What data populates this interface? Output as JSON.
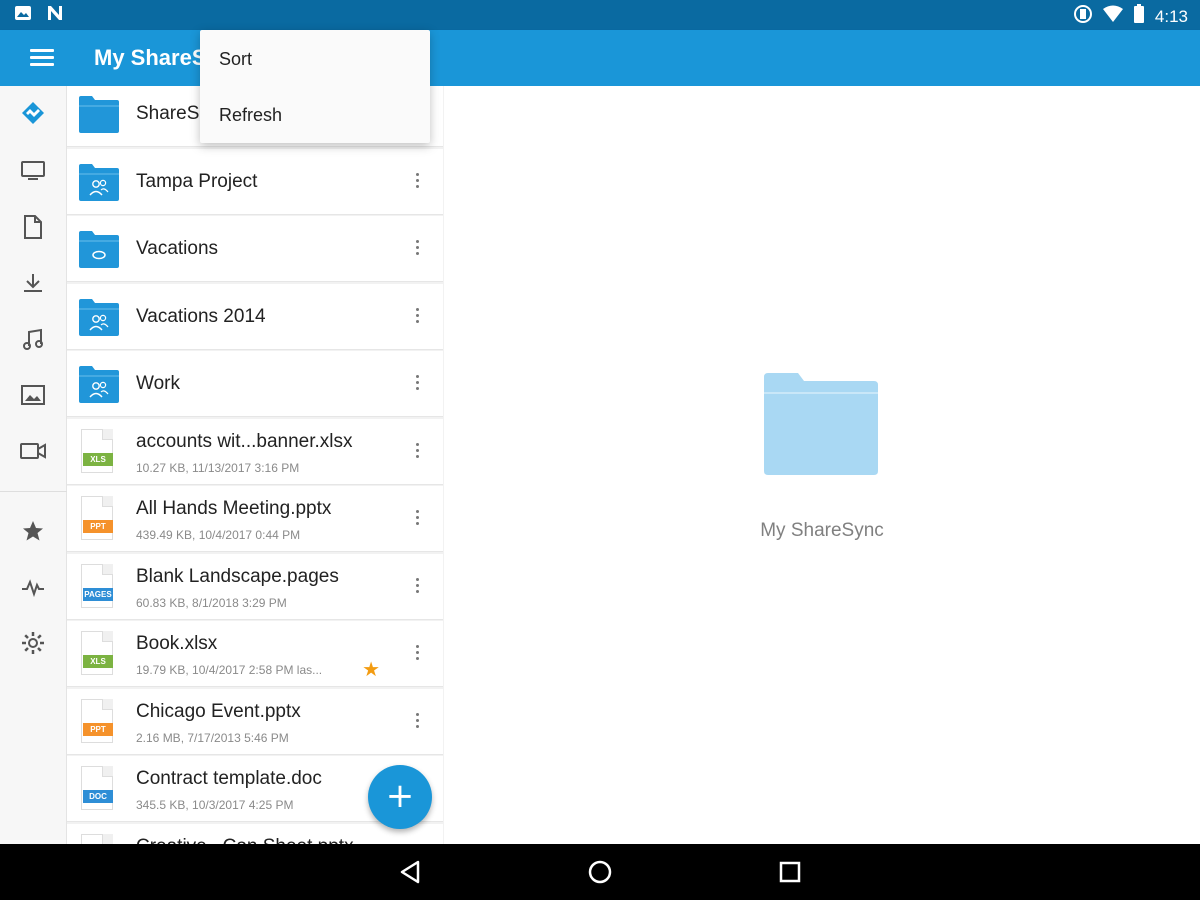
{
  "status_bar": {
    "time": "4:13"
  },
  "app_bar": {
    "title": "My ShareSync"
  },
  "menu": {
    "items": [
      {
        "label": "Sort"
      },
      {
        "label": "Refresh"
      }
    ]
  },
  "rail": {
    "items": [
      "sharesync-icon",
      "computer-icon",
      "document-icon",
      "download-icon",
      "music-icon",
      "image-icon",
      "video-icon",
      "star-icon",
      "activity-icon",
      "settings-icon"
    ]
  },
  "files": [
    {
      "name": "ShareS",
      "type": "folder",
      "variant": "plain"
    },
    {
      "name": "Tampa Project",
      "type": "folder",
      "variant": "shared"
    },
    {
      "name": "Vacations",
      "type": "folder",
      "variant": "link"
    },
    {
      "name": "Vacations 2014",
      "type": "folder",
      "variant": "shared"
    },
    {
      "name": "Work",
      "type": "folder",
      "variant": "shared"
    },
    {
      "name": "accounts wit...banner.xlsx",
      "type": "file",
      "badge": "XLS",
      "badge_color": "#7cb342",
      "meta": "10.27 KB, 11/13/2017 3:16 PM"
    },
    {
      "name": "All Hands Meeting.pptx",
      "type": "file",
      "badge": "PPT",
      "badge_color": "#f5922b",
      "meta": "439.49 KB, 10/4/2017 0:44 PM"
    },
    {
      "name": "Blank Landscape.pages",
      "type": "file",
      "badge": "PAGES",
      "badge_color": "#2e8ed6",
      "meta": "60.83 KB, 8/1/2018 3:29 PM"
    },
    {
      "name": "Book.xlsx",
      "type": "file",
      "badge": "XLS",
      "badge_color": "#7cb342",
      "meta": "19.79 KB, 10/4/2017 2:58 PM las...",
      "starred": true
    },
    {
      "name": "Chicago Event.pptx",
      "type": "file",
      "badge": "PPT",
      "badge_color": "#f5922b",
      "meta": "2.16 MB, 7/17/2013 5:46 PM"
    },
    {
      "name": "Contract template.doc",
      "type": "file",
      "badge": "DOC",
      "badge_color": "#2e8ed6",
      "meta": "345.5 KB, 10/3/2017 4:25 PM"
    },
    {
      "name": "Creative...Con Sheet.pptx",
      "type": "file",
      "badge": "",
      "badge_color": "#f5922b",
      "meta": ""
    }
  ],
  "detail": {
    "label": "My ShareSync"
  },
  "fab": {
    "label": "+"
  },
  "colors": {
    "primary": "#1a96d8",
    "status_bar": "#0a6aa1",
    "folder": "#2196d9",
    "folder_light": "#a9d8f3",
    "star": "#f39c12"
  }
}
